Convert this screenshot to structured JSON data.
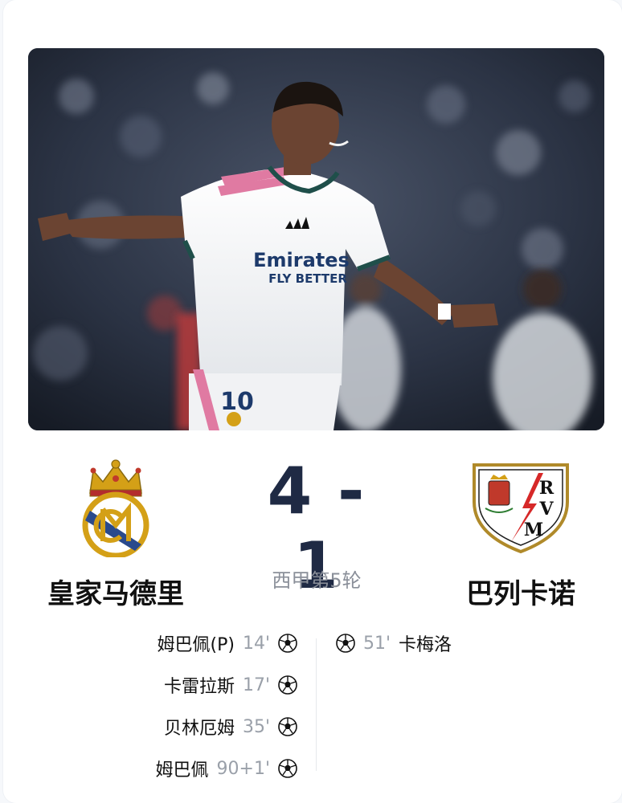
{
  "match": {
    "score_display": "4 - 1",
    "round": "西甲第5轮"
  },
  "home": {
    "name": "皇家马德里",
    "goals": [
      {
        "player": "姆巴佩(P)",
        "minute": "14'"
      },
      {
        "player": "卡雷拉斯",
        "minute": "17'"
      },
      {
        "player": "贝林厄姆",
        "minute": "35'"
      },
      {
        "player": "姆巴佩",
        "minute": "90+1'"
      }
    ]
  },
  "away": {
    "name": "巴列卡诺",
    "crest_letters": "RVM",
    "goals": [
      {
        "player": "卡梅洛",
        "minute": "51'"
      }
    ]
  },
  "hero": {
    "shirt_sponsor": "Emirates",
    "shirt_sponsor_line2": "FLY BETTER",
    "shirt_number": "10"
  },
  "colors": {
    "score": "#1f2a44",
    "round": "#8a8f99",
    "minute": "#9aa0a9",
    "madrid_gold": "#d4a017",
    "madrid_blue": "#2a4a8c",
    "rayo_red": "#d62828"
  }
}
